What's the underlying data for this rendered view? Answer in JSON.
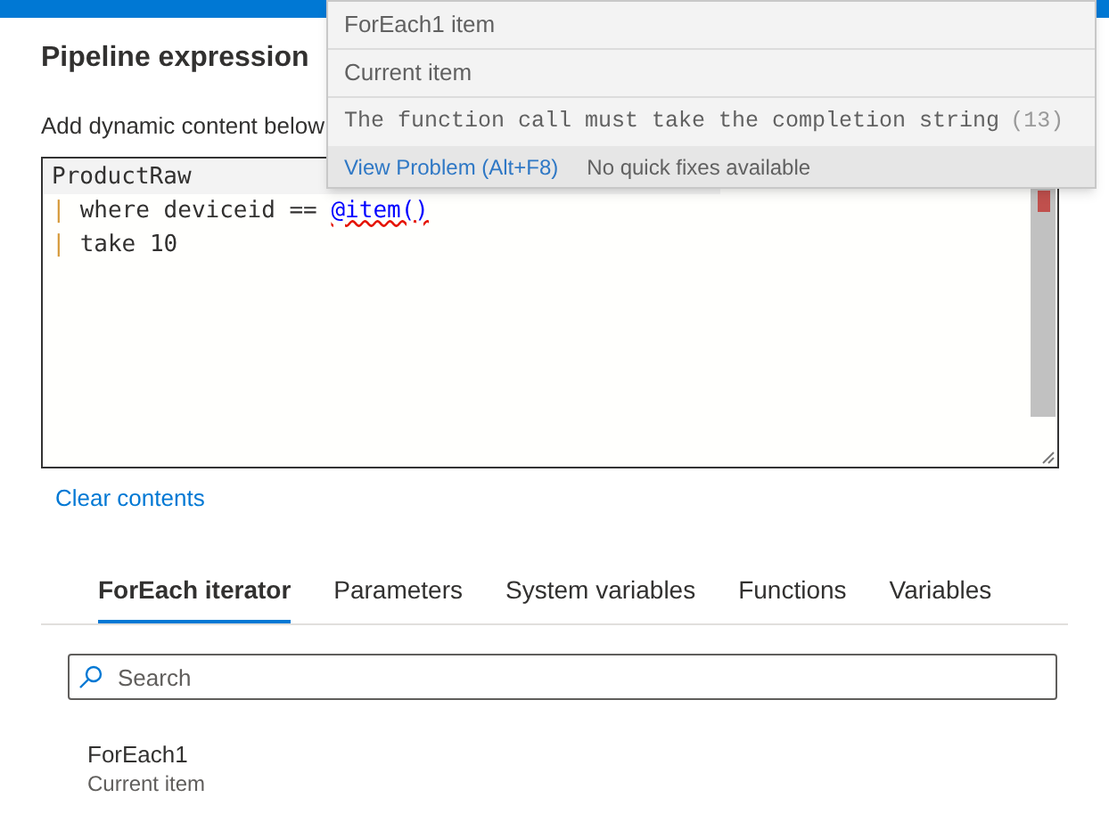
{
  "dialog": {
    "title": "Pipeline expression",
    "description": "Add dynamic content below"
  },
  "editor": {
    "lines": [
      {
        "current": true,
        "text": "ProductRaw"
      },
      {
        "current": false,
        "pipe": "|",
        "text": "where deviceid == ",
        "error_token": "@item()"
      },
      {
        "current": false,
        "pipe": "|",
        "text": "take 10"
      }
    ]
  },
  "hover_popup": {
    "suggestions": [
      {
        "label": "ForEach1 item"
      },
      {
        "label": "Current item"
      }
    ],
    "message": "The function call must take the completion string",
    "code": "(13)",
    "actions": [
      {
        "label": "View Problem (Alt+F8)",
        "kind": "link"
      },
      {
        "label": "No quick fixes available",
        "kind": "note"
      }
    ]
  },
  "clear_link": "Clear contents",
  "tabs": [
    {
      "label": "ForEach iterator",
      "selected": true
    },
    {
      "label": "Parameters",
      "selected": false
    },
    {
      "label": "System variables",
      "selected": false
    },
    {
      "label": "Functions",
      "selected": false
    },
    {
      "label": "Variables",
      "selected": false
    }
  ],
  "search": {
    "placeholder": "Search"
  },
  "items": [
    {
      "name": "ForEach1",
      "description": "Current item"
    }
  ]
}
